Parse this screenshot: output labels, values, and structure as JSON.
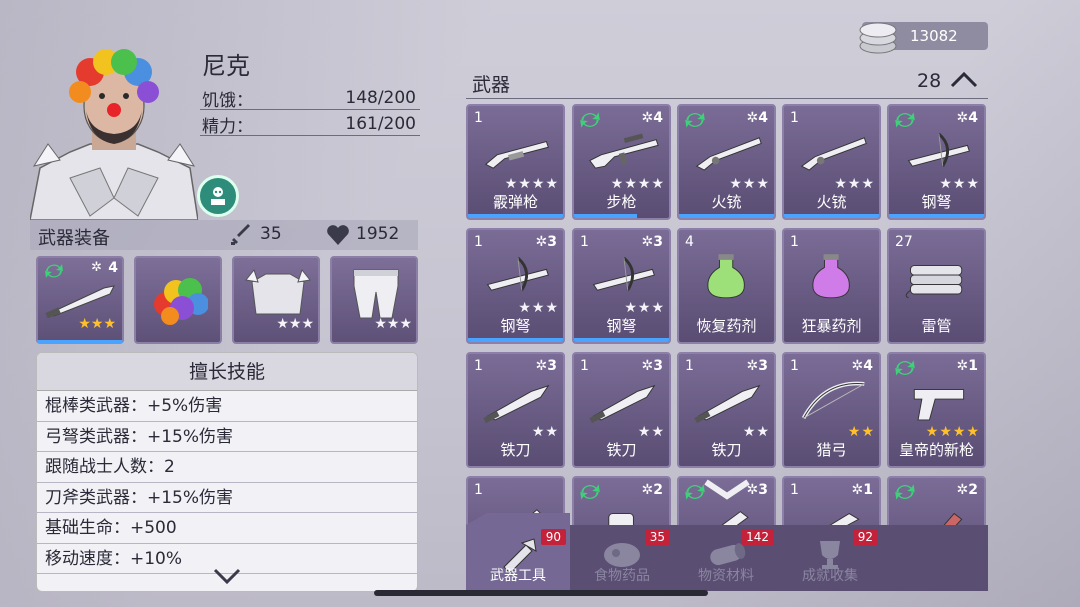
{
  "character": {
    "name": "尼克",
    "hunger_label": "饥饿：",
    "hunger_value": "148/200",
    "energy_label": "精力：",
    "energy_value": "161/200"
  },
  "equipment": {
    "title": "武器装备",
    "attack": "35",
    "health": "1952",
    "slots": [
      {
        "level": "4",
        "stars": 3,
        "star_color": "gold"
      },
      {
        "level": "",
        "stars": 0
      },
      {
        "level": "",
        "stars": 3,
        "star_color": "white"
      },
      {
        "level": "",
        "stars": 3,
        "star_color": "white"
      }
    ]
  },
  "skills": {
    "title": "擅长技能",
    "lines": [
      "棍棒类武器：+5%伤害",
      "弓弩类武器：+15%伤害",
      "跟随战士人数：2",
      "刀斧类武器：+15%伤害",
      "基础生命：+500",
      "移动速度：+10%"
    ]
  },
  "currency": {
    "value": "13082"
  },
  "category": {
    "title": "武器",
    "count": "28"
  },
  "items": [
    {
      "qty": "1",
      "lvl": "",
      "refresh": false,
      "name": "霰弹枪",
      "stars": 4,
      "star_color": "white",
      "pic": "shotgun",
      "dur": 1.0
    },
    {
      "qty": "",
      "lvl": "4",
      "refresh": true,
      "name": "步枪",
      "stars": 4,
      "star_color": "white",
      "pic": "rifle",
      "dur": 0.66
    },
    {
      "qty": "",
      "lvl": "4",
      "refresh": true,
      "name": "火铳",
      "stars": 3,
      "star_color": "white",
      "pic": "musket",
      "dur": 1.0
    },
    {
      "qty": "1",
      "lvl": "",
      "refresh": false,
      "name": "火铳",
      "stars": 3,
      "star_color": "white",
      "pic": "musket",
      "dur": 1.0
    },
    {
      "qty": "",
      "lvl": "4",
      "refresh": true,
      "name": "钢弩",
      "stars": 3,
      "star_color": "white",
      "pic": "crossbow",
      "dur": 1.0
    },
    {
      "qty": "1",
      "lvl": "3",
      "refresh": false,
      "name": "钢弩",
      "stars": 3,
      "star_color": "white",
      "pic": "crossbow",
      "dur": 1.0
    },
    {
      "qty": "1",
      "lvl": "3",
      "refresh": false,
      "name": "钢弩",
      "stars": 3,
      "star_color": "white",
      "pic": "crossbow",
      "dur": 1.0
    },
    {
      "qty": "4",
      "lvl": "",
      "refresh": false,
      "name": "恢复药剂",
      "stars": 0,
      "pic": "potion-green",
      "dur": 0
    },
    {
      "qty": "1",
      "lvl": "",
      "refresh": false,
      "name": "狂暴药剂",
      "stars": 0,
      "pic": "potion-purple",
      "dur": 0
    },
    {
      "qty": "27",
      "lvl": "",
      "refresh": false,
      "name": "雷管",
      "stars": 0,
      "pic": "dynamite",
      "dur": 0
    },
    {
      "qty": "1",
      "lvl": "3",
      "refresh": false,
      "name": "铁刀",
      "stars": 2,
      "star_color": "white",
      "pic": "knife",
      "dur": 0
    },
    {
      "qty": "1",
      "lvl": "3",
      "refresh": false,
      "name": "铁刀",
      "stars": 2,
      "star_color": "white",
      "pic": "knife",
      "dur": 0
    },
    {
      "qty": "1",
      "lvl": "3",
      "refresh": false,
      "name": "铁刀",
      "stars": 2,
      "star_color": "white",
      "pic": "knife",
      "dur": 0
    },
    {
      "qty": "1",
      "lvl": "4",
      "refresh": false,
      "name": "猎弓",
      "stars": 2,
      "star_color": "gold",
      "pic": "bow",
      "dur": 0
    },
    {
      "qty": "",
      "lvl": "1",
      "refresh": true,
      "name": "皇帝的新枪",
      "stars": 4,
      "star_color": "gold",
      "pic": "pistol",
      "dur": 0
    },
    {
      "qty": "1",
      "lvl": "",
      "refresh": false,
      "name": "",
      "stars": 0,
      "pic": "blade",
      "dur": 0
    },
    {
      "qty": "",
      "lvl": "2",
      "refresh": true,
      "name": "",
      "stars": 0,
      "pic": "canister",
      "dur": 0
    },
    {
      "qty": "",
      "lvl": "3",
      "refresh": true,
      "name": "",
      "stars": 0,
      "pic": "wrench",
      "dur": 0
    },
    {
      "qty": "1",
      "lvl": "1",
      "refresh": false,
      "name": "",
      "stars": 0,
      "pic": "club",
      "dur": 0
    },
    {
      "qty": "",
      "lvl": "2",
      "refresh": true,
      "name": "",
      "stars": 0,
      "pic": "axe",
      "dur": 0
    }
  ],
  "tabs": [
    {
      "label": "武器工具",
      "badge": "90",
      "icon": "tools-icon",
      "active": true
    },
    {
      "label": "食物药品",
      "badge": "35",
      "icon": "meat-icon",
      "active": false
    },
    {
      "label": "物资材料",
      "badge": "142",
      "icon": "log-icon",
      "active": false
    },
    {
      "label": "成就收集",
      "badge": "92",
      "icon": "trophy-icon",
      "active": false
    }
  ]
}
